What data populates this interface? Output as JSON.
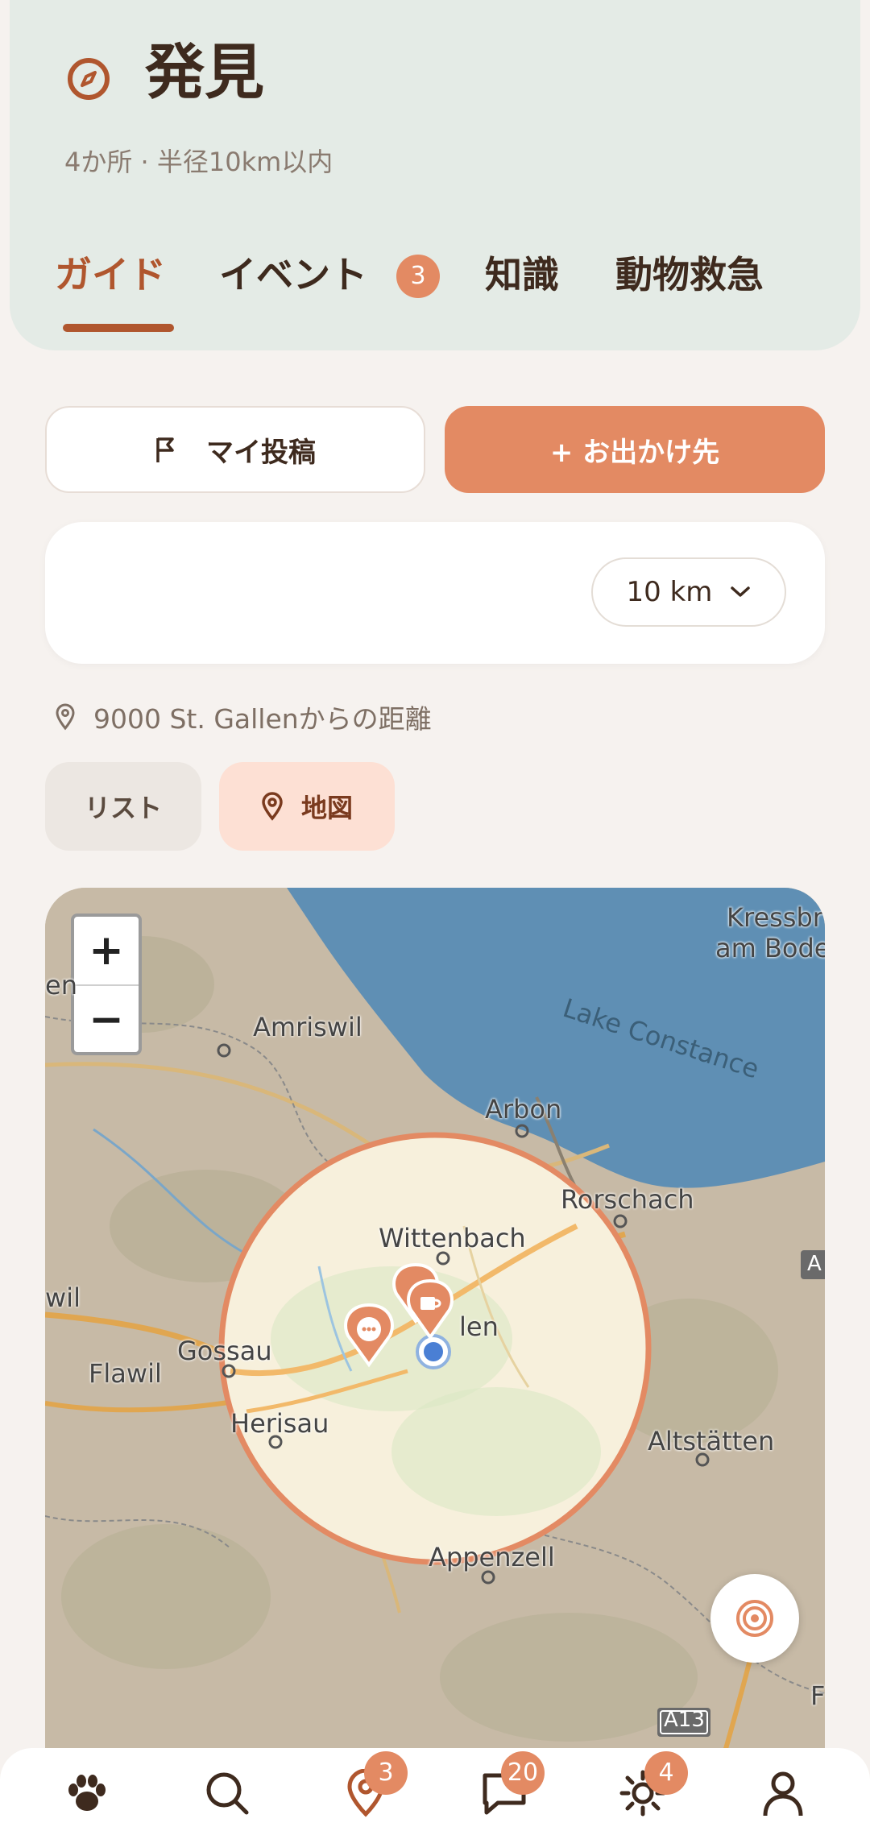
{
  "header": {
    "title": "発見",
    "subtitle": "4か所 · 半径10km以内",
    "tabs": [
      {
        "label": "ガイド",
        "active": true
      },
      {
        "label": "イベント",
        "badge": "3"
      },
      {
        "label": "知識"
      },
      {
        "label": "動物救急"
      }
    ]
  },
  "actions": {
    "my_posts": "マイ投稿",
    "add_destination": "+ お出かけ先"
  },
  "filter": {
    "radius": "10 km"
  },
  "distance_from": "9000 St. Gallenからの距離",
  "view_toggle": {
    "list": "リスト",
    "map": "地図",
    "selected": "map"
  },
  "map": {
    "zoom_in": "+",
    "zoom_out": "−",
    "places": {
      "kressbronn": "Kressbr",
      "am_bodensee": "am Bode",
      "amriswil": "Amriswil",
      "arbon": "Arbon",
      "lake": "Lake Constance",
      "rorschach": "Rorschach",
      "wittenbach": "Wittenbach",
      "gossau": "Gossau",
      "flawil": "Flawil",
      "herisau": "Herisau",
      "stgallen": "len",
      "altstatten": "Altstätten",
      "appenzell": "Appenzell",
      "wil": "wil",
      "en": "en",
      "a13": "A13",
      "a_road": "A",
      "f": "F"
    }
  },
  "bottom_nav": {
    "items": [
      {
        "icon": "paw-icon"
      },
      {
        "icon": "search-icon"
      },
      {
        "icon": "map-pin-icon",
        "badge": "3",
        "active": true
      },
      {
        "icon": "chat-icon",
        "badge": "20"
      },
      {
        "icon": "sun-icon",
        "badge": "4"
      },
      {
        "icon": "profile-icon"
      }
    ]
  },
  "colors": {
    "accent": "#e38a63",
    "accent_dark": "#b0562e",
    "header_bg": "#e4ebe6",
    "text": "#3e2a1e"
  }
}
